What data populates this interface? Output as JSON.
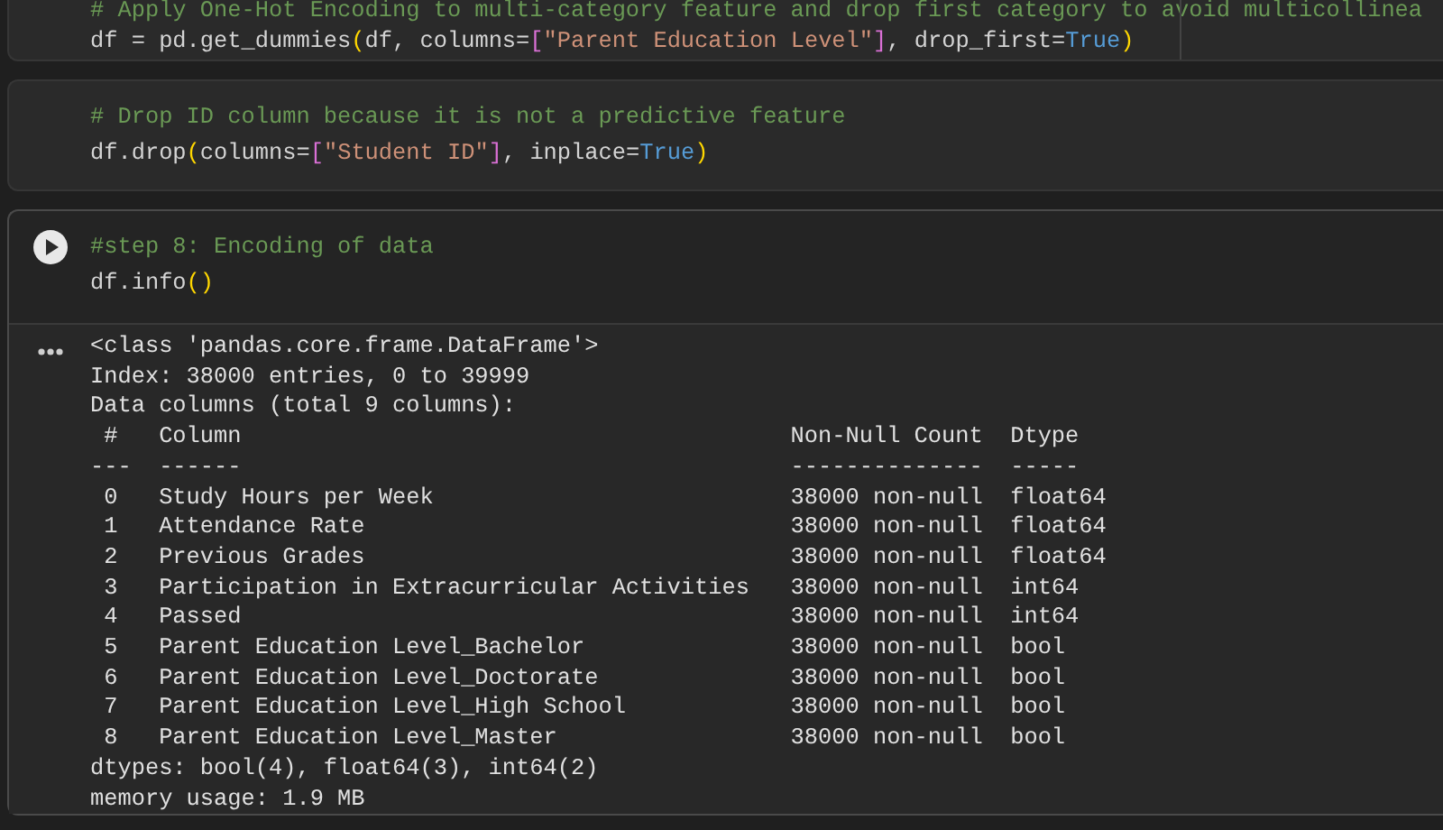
{
  "cells": [
    {
      "kind": "code",
      "run_button": false,
      "ruler": true,
      "lines": [
        [
          {
            "kind": "comment",
            "text": "# Apply One-Hot Encoding to multi-category feature and drop first category to avoid multicollinea"
          }
        ],
        [
          {
            "kind": "plain",
            "text": "df = pd.get_dummies"
          },
          {
            "kind": "paren",
            "text": "("
          },
          {
            "kind": "plain",
            "text": "df, columns="
          },
          {
            "kind": "bracket",
            "text": "["
          },
          {
            "kind": "string",
            "text": "\"Parent Education Level\""
          },
          {
            "kind": "bracket",
            "text": "]"
          },
          {
            "kind": "plain",
            "text": ", drop_first="
          },
          {
            "kind": "keyword",
            "text": "True"
          },
          {
            "kind": "paren",
            "text": ")"
          }
        ]
      ]
    },
    {
      "kind": "code",
      "run_button": false,
      "ruler": false,
      "lines": [
        [
          {
            "kind": "comment",
            "text": "# Drop ID column because it is not a predictive feature"
          }
        ],
        [
          {
            "kind": "plain",
            "text": "df.drop"
          },
          {
            "kind": "paren",
            "text": "("
          },
          {
            "kind": "plain",
            "text": "columns="
          },
          {
            "kind": "bracket",
            "text": "["
          },
          {
            "kind": "string",
            "text": "\"Student ID\""
          },
          {
            "kind": "bracket",
            "text": "]"
          },
          {
            "kind": "plain",
            "text": ", inplace="
          },
          {
            "kind": "keyword",
            "text": "True"
          },
          {
            "kind": "paren",
            "text": ")"
          }
        ]
      ]
    },
    {
      "kind": "code",
      "run_button": true,
      "ruler": false,
      "lines": [
        [
          {
            "kind": "comment",
            "text": "#step 8: Encoding of data"
          }
        ],
        [
          {
            "kind": "plain",
            "text": "df.info"
          },
          {
            "kind": "paren",
            "text": "()"
          }
        ]
      ],
      "output": {
        "head": [
          "<class 'pandas.core.frame.DataFrame'>",
          "Index: 38000 entries, 0 to 39999",
          "Data columns (total 9 columns):"
        ],
        "table": {
          "columns": [
            "#",
            "Column",
            "Non-Null Count",
            "Dtype"
          ],
          "rules": [
            "---",
            "------",
            "--------------",
            "-----"
          ],
          "rows": [
            [
              "0",
              "Study Hours per Week",
              "38000 non-null",
              "float64"
            ],
            [
              "1",
              "Attendance Rate",
              "38000 non-null",
              "float64"
            ],
            [
              "2",
              "Previous Grades",
              "38000 non-null",
              "float64"
            ],
            [
              "3",
              "Participation in Extracurricular Activities",
              "38000 non-null",
              "int64"
            ],
            [
              "4",
              "Passed",
              "38000 non-null",
              "int64"
            ],
            [
              "5",
              "Parent Education Level_Bachelor",
              "38000 non-null",
              "bool"
            ],
            [
              "6",
              "Parent Education Level_Doctorate",
              "38000 non-null",
              "bool"
            ],
            [
              "7",
              "Parent Education Level_High School",
              "38000 non-null",
              "bool"
            ],
            [
              "8",
              "Parent Education Level_Master",
              "38000 non-null",
              "bool"
            ]
          ]
        },
        "foot": [
          "dtypes: bool(4), float64(3), int64(2)",
          "memory usage: 1.9 MB"
        ]
      }
    }
  ]
}
